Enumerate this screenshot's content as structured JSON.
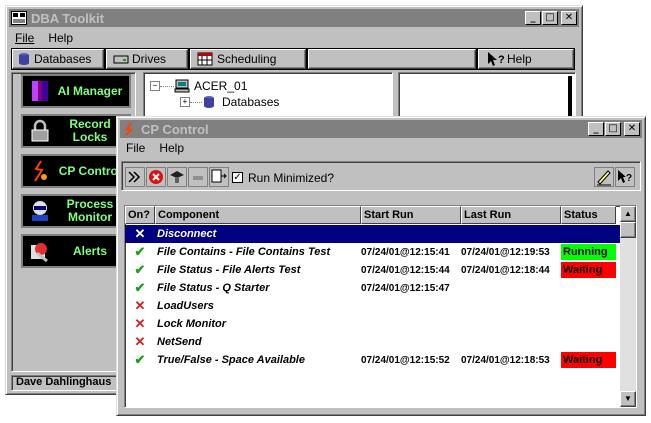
{
  "main_window": {
    "title": "DBA Toolkit",
    "menu": [
      "File",
      "Help"
    ],
    "toolbar": {
      "databases": "Databases",
      "drives": "Drives",
      "scheduling": "Scheduling",
      "help": "Help"
    },
    "nav": [
      {
        "label": "AI Manager",
        "icon": "ai-manager-icon"
      },
      {
        "label": "Record Locks",
        "icon": "padlock-icon"
      },
      {
        "label": "CP Control",
        "icon": "cp-control-icon"
      },
      {
        "label": "Process Monitor",
        "icon": "process-monitor-icon"
      },
      {
        "label": "Alerts",
        "icon": "alerts-icon"
      }
    ],
    "tree": {
      "root": "ACER_01",
      "child": "Databases"
    },
    "status_user": "Dave Dahlinghaus"
  },
  "cp_window": {
    "title": "CP Control",
    "menu": [
      "File",
      "Help"
    ],
    "run_minimized_label": "Run Minimized?",
    "run_minimized_checked": true,
    "columns": [
      "On?",
      "Component",
      "Start Run",
      "Last Run",
      "Status"
    ],
    "rows": [
      {
        "on": "x",
        "component": "Disconnect",
        "start": "",
        "last": "",
        "status": "",
        "selected": true
      },
      {
        "on": "check",
        "component": "File Contains - File Contains Test",
        "start": "07/24/01@12:15:41",
        "last": "07/24/01@12:19:53",
        "status": "Running",
        "status_color": "#00ff00"
      },
      {
        "on": "check",
        "component": "File Status - File Alerts Test",
        "start": "07/24/01@12:15:44",
        "last": "07/24/01@12:18:44",
        "status": "Waiting",
        "status_color": "#ff0000"
      },
      {
        "on": "check",
        "component": "File Status - Q Starter",
        "start": "07/24/01@12:15:47",
        "last": "",
        "status": ""
      },
      {
        "on": "x",
        "component": "LoadUsers",
        "start": "",
        "last": "",
        "status": ""
      },
      {
        "on": "x",
        "component": "Lock Monitor",
        "start": "",
        "last": "",
        "status": ""
      },
      {
        "on": "x",
        "component": "NetSend",
        "start": "",
        "last": "",
        "status": ""
      },
      {
        "on": "check",
        "component": "True/False - Space Available",
        "start": "07/24/01@12:15:52",
        "last": "07/24/01@12:18:53",
        "status": "Waiting",
        "status_color": "#ff0000"
      }
    ]
  },
  "colors": {
    "selection": "#000080",
    "inactive_title": "#808080",
    "active_title": "#000080",
    "running": "#00ff00",
    "waiting": "#ff0000"
  }
}
